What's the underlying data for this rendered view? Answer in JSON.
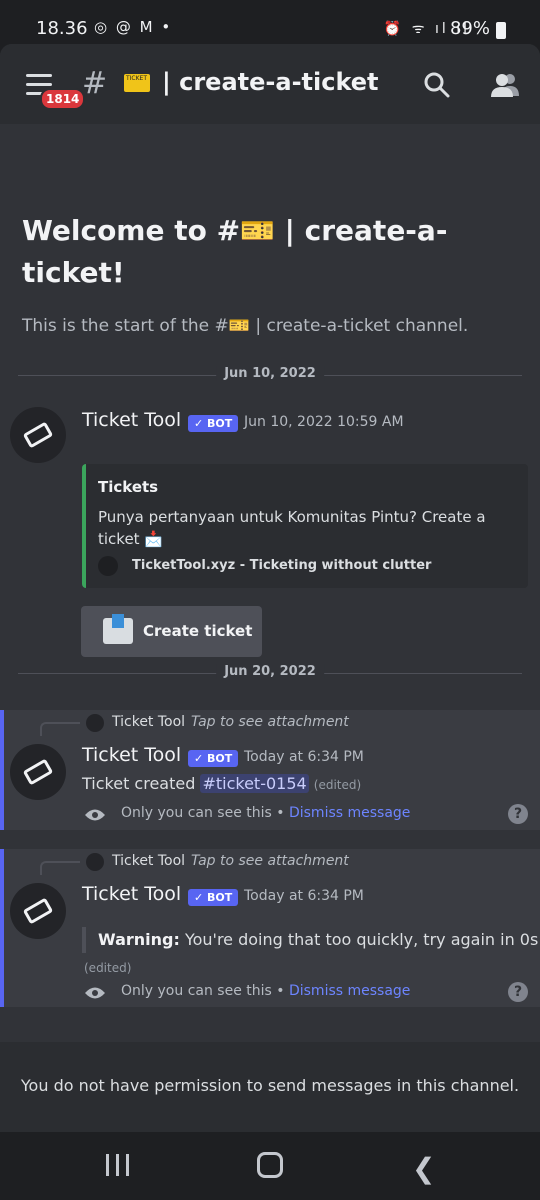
{
  "status_bar": {
    "time": "18.36",
    "left_icons": "◎ @ M •",
    "right_icons": "⏰ ᯤ ıl ıl",
    "battery": "89%"
  },
  "header": {
    "unread_badge": "1814",
    "channel_name": "| create-a-ticket",
    "emoji_text": "TICKET"
  },
  "welcome": {
    "title": "Welcome to #🎫 | create-a-ticket!",
    "subtitle": "This is the start of the #🎫 | create-a-ticket channel."
  },
  "dividers": [
    "Jun 10, 2022",
    "Jun 20, 2022"
  ],
  "first_message": {
    "author": "Ticket Tool",
    "bot_tag": "✓ BOT",
    "timestamp": "Jun 10, 2022 10:59 AM",
    "embed": {
      "title": "Tickets",
      "description": "Punya pertanyaan untuk Komunitas Pintu? Create a ticket 📩",
      "footer": "TicketTool.xyz - Ticketing without clutter",
      "accent_color": "#3ba55c"
    },
    "button_label": "Create ticket"
  },
  "ephemeral_1": {
    "reply_author": "Ticket Tool",
    "reply_hint": "Tap to see attachment",
    "author": "Ticket Tool",
    "bot_tag": "✓ BOT",
    "timestamp": "Today at 6:34 PM",
    "text_prefix": "Ticket created ",
    "mention": "#ticket-0154",
    "edited": "(edited)",
    "only_you": "Only you can see this • ",
    "dismiss": "Dismiss message",
    "help": "?"
  },
  "ephemeral_2": {
    "reply_author": "Ticket Tool",
    "reply_hint": "Tap to see attachment",
    "author": "Ticket Tool",
    "bot_tag": "✓ BOT",
    "timestamp": "Today at 6:34 PM",
    "warning_label": "Warning:",
    "warning_text": " You're doing that too quickly, try again in 0s",
    "edited": "(edited)",
    "only_you": "Only you can see this • ",
    "dismiss": "Dismiss message",
    "help": "?"
  },
  "footer_notice": "You do not have permission to send messages in this channel.",
  "colors": {
    "accent": "#5865f2",
    "link": "#6d85ff",
    "badge": "#da373c"
  }
}
